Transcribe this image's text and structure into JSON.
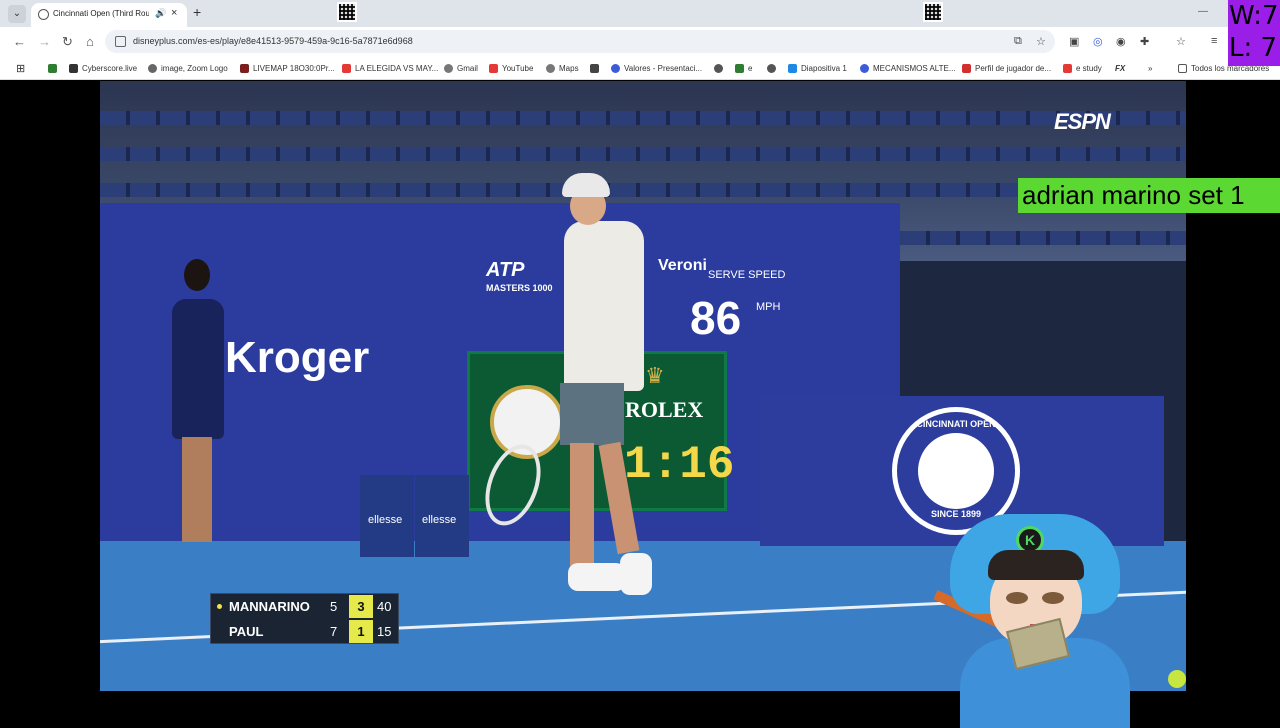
{
  "browser": {
    "tab": {
      "title": "Cincinnati Open (Third Rou",
      "close_label": "×"
    },
    "new_tab_label": "+",
    "url": "disneyplus.com/es-es/play/e8e41513-9579-459a-9c16-5a7871e6d968",
    "bookmarks": [
      {
        "label": "Cyberscore.live",
        "color": "#2e7d32"
      },
      {
        "label": "image, Zoom Logo",
        "color": "#666666"
      },
      {
        "label": "LIVEMAP 18O30:0Pr...",
        "color": "#7b1e1e"
      },
      {
        "label": "LA ELEGIDA VS MAY...",
        "color": "#e53935"
      },
      {
        "label": "Gmail",
        "color": "#777777"
      },
      {
        "label": "YouTube",
        "color": "#e53935"
      },
      {
        "label": "Maps",
        "color": "#777777"
      },
      {
        "label": "",
        "color": "#444444"
      },
      {
        "label": "Valores - Presentaci...",
        "color": "#3b5bdb"
      },
      {
        "label": "",
        "color": "#555555"
      },
      {
        "label": "e",
        "color": "#2e7d32"
      },
      {
        "label": "",
        "color": "#555555"
      },
      {
        "label": "Diapositiva 1",
        "color": "#1e88e5"
      },
      {
        "label": "MECANISMOS ALTE...",
        "color": "#3b5bdb"
      },
      {
        "label": "Perfil de jugador de...",
        "color": "#d32f2f"
      },
      {
        "label": "e study",
        "color": "#e53935"
      },
      {
        "label": "FX",
        "color": "#222222"
      }
    ],
    "all_bookmarks_label": "Todos los marcadores"
  },
  "stream_overlay": {
    "wins_label": "W:7",
    "losses_label": "L: 7",
    "banner_text": "adrian marino set 1"
  },
  "broadcast": {
    "network_logo": "ESPN",
    "sponsor_main": "Kroger",
    "atp_label": "ATP",
    "atp_sub": "MASTERS 1000",
    "serve_sponsor": "Veroni",
    "serve_speed_label": "SERVE SPEED",
    "serve_speed_value": "86",
    "serve_speed_unit": "MPH",
    "clock_brand": "ROLEX",
    "clock_time": "1:16",
    "tournament_top": "CINCINNATI OPEN",
    "tournament_bottom": "SINCE 1899",
    "ellesse_1": "ellesse",
    "ellesse_2": "ellesse"
  },
  "scoreboard": {
    "players": [
      {
        "name": "MANNARINO",
        "set1": "5",
        "games": "3",
        "points": "40",
        "serving": true
      },
      {
        "name": "PAUL",
        "set1": "7",
        "games": "1",
        "points": "15",
        "serving": false
      }
    ]
  },
  "avatar_badge": "K"
}
